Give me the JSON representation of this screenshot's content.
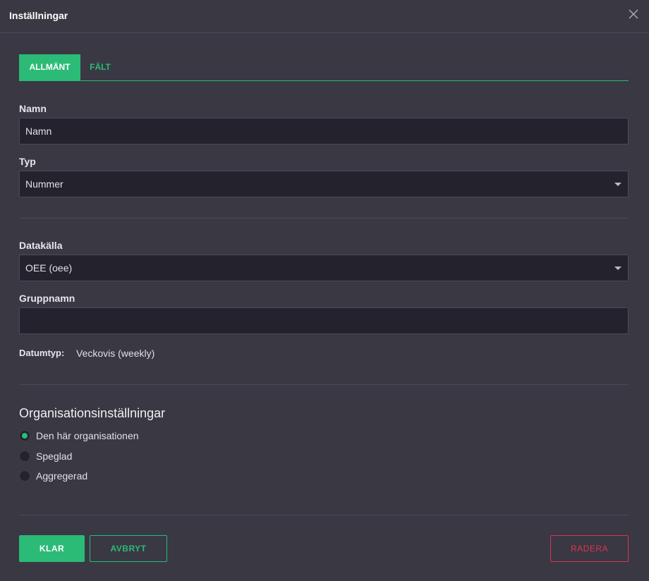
{
  "header": {
    "title": "Inställningar"
  },
  "tabs": [
    {
      "label": "ALLMÄNT"
    },
    {
      "label": "FÄLT"
    }
  ],
  "form": {
    "name_label": "Namn",
    "name_value": "Namn",
    "type_label": "Typ",
    "type_value": "Nummer",
    "source_label": "Datakälla",
    "source_value": "OEE (oee)",
    "group_label": "Gruppnamn",
    "group_value": "",
    "datetype_label": "Datumtyp:",
    "datetype_value": "Veckovis (weekly)"
  },
  "org": {
    "heading": "Organisationsinställningar",
    "options": [
      {
        "label": "Den här organisationen",
        "selected": true
      },
      {
        "label": "Speglad",
        "selected": false
      },
      {
        "label": "Aggregerad",
        "selected": false
      }
    ]
  },
  "buttons": {
    "done": "KLAR",
    "cancel": "AVBRYT",
    "delete": "RADERA"
  },
  "colors": {
    "accent": "#2bbb77",
    "danger": "#e0334f"
  }
}
